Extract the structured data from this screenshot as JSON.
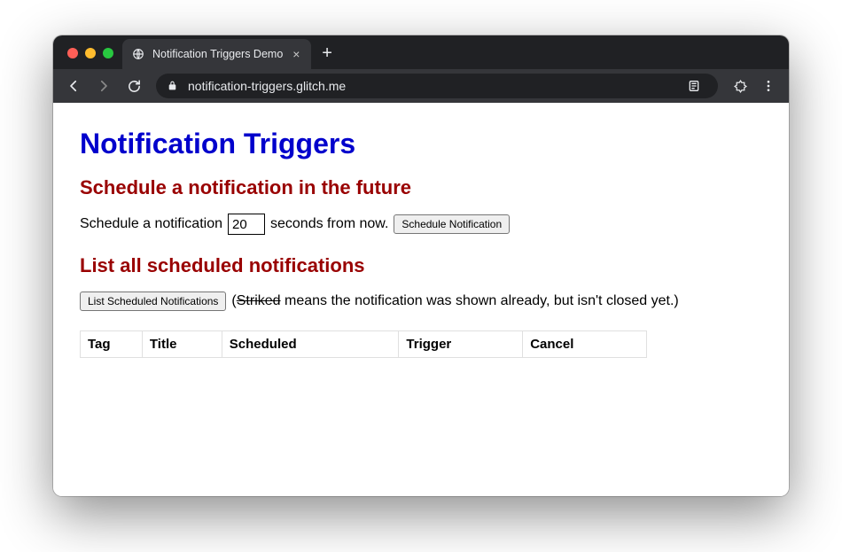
{
  "browser": {
    "tab_title": "Notification Triggers Demo",
    "url": "notification-triggers.glitch.me"
  },
  "page": {
    "title": "Notification Triggers",
    "schedule_section": {
      "heading": "Schedule a notification in the future",
      "text_before": "Schedule a notification",
      "seconds_value": "20",
      "text_after": "seconds from now.",
      "button_label": "Schedule Notification"
    },
    "list_section": {
      "heading": "List all scheduled notifications",
      "button_label": "List Scheduled Notifications",
      "legend_prefix": "(",
      "legend_striked": "Striked",
      "legend_rest": " means the notification was shown already, but isn't closed yet.)",
      "columns": [
        "Tag",
        "Title",
        "Scheduled",
        "Trigger",
        "Cancel"
      ]
    }
  }
}
